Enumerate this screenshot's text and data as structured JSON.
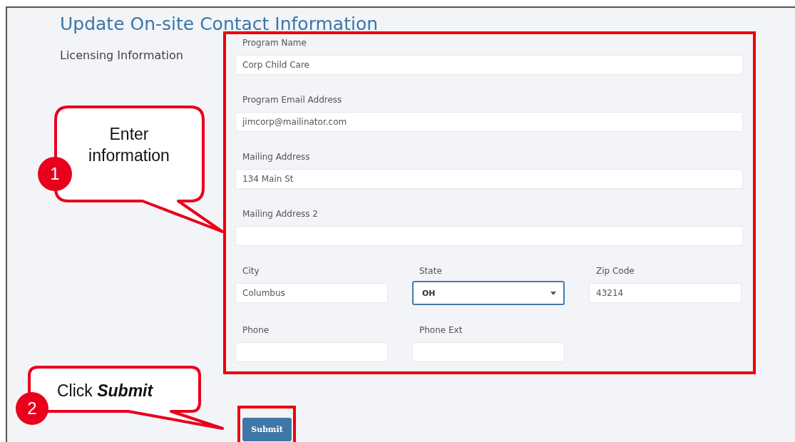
{
  "title": "Update On-site Contact Information",
  "section_label": "Licensing Information",
  "rows": [
    [
      {
        "label": "Program Name",
        "value": "Corp Child Care",
        "kind": "text",
        "focused": false
      }
    ],
    [
      {
        "label": "Program Email Address",
        "value": "jimcorp@mailinator.com",
        "kind": "text",
        "focused": false
      }
    ],
    [
      {
        "label": "Mailing Address",
        "value": "134 Main St",
        "kind": "text",
        "focused": false
      }
    ],
    [
      {
        "label": "Mailing Address 2",
        "kind": "text",
        "focused": false
      }
    ],
    [
      {
        "label": "City",
        "value": "Columbus",
        "kind": "text",
        "focused": false
      },
      {
        "label": "State",
        "value": "OH",
        "kind": "select",
        "focused": true
      },
      {
        "label": "Zip Code",
        "value": "43214",
        "kind": "text",
        "focused": false
      }
    ],
    [
      {
        "label": "Phone",
        "kind": "text",
        "focused": false
      },
      {
        "label": "Phone Ext",
        "kind": "text",
        "focused": false
      }
    ]
  ],
  "submit_button": "Submit",
  "callouts": [
    {
      "number": "1",
      "text": "Enter information"
    },
    {
      "number": "2",
      "text": "Click **Submit**"
    }
  ]
}
